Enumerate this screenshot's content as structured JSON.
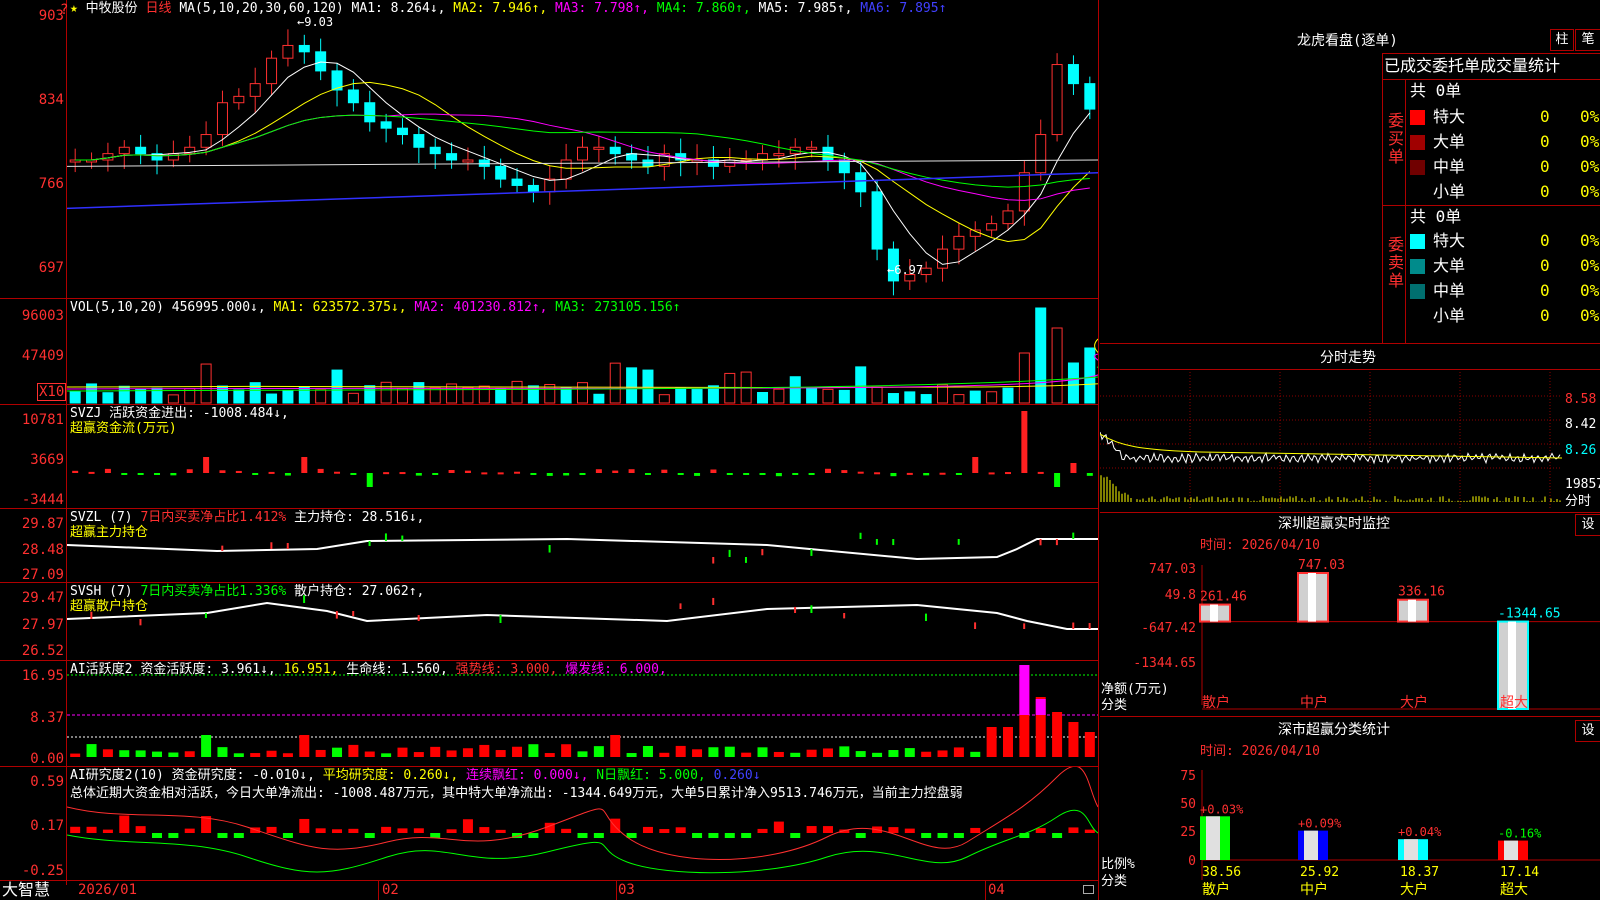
{
  "stock": {
    "star": "★",
    "name": "中牧股份",
    "period": "日线"
  },
  "ma_line": {
    "label": "MA(5,10,20,30,60,120)",
    "ma1": "MA1: 8.264↓,",
    "ma2": "MA2: 7.946↑,",
    "ma3": "MA3: 7.798↑,",
    "ma4": "MA4: 7.860↑,",
    "ma5": "MA5: 7.985↑,",
    "ma6": "MA6: 7.895↑"
  },
  "price_axis": [
    "903",
    "834",
    "766",
    "697"
  ],
  "price_annotations": {
    "high": "←9.03",
    "low": "←6.97"
  },
  "vol": {
    "label": "VOL(5,10,20)",
    "value": "456995.000↓,",
    "ma1": "MA1: 623572.375↓,",
    "ma2": "MA2: 401230.812↑,",
    "ma3": "MA3: 273105.156↑",
    "axis": [
      "96003",
      "47409"
    ],
    "unit": "X10"
  },
  "svzj": {
    "title": "SVZJ",
    "label": "活跃资金进出: -1008.484↓,",
    "sub": "超赢资金流(万元)",
    "axis": [
      "10781",
      "3669",
      "-3444"
    ]
  },
  "svzl": {
    "title": "SVZL (7)",
    "ratio": "7日内买卖净占比1.412%",
    "hold": "主力持仓: 28.516↓,",
    "sub": "超赢主力持仓",
    "axis": [
      "29.87",
      "28.48",
      "27.09"
    ]
  },
  "svsh": {
    "title": "SVSH (7)",
    "ratio": "7日内买卖净占比1.336%",
    "hold": "散户持仓: 27.062↑,",
    "sub": "超赢散户持仓",
    "axis": [
      "29.47",
      "27.97",
      "26.52"
    ]
  },
  "ai_active": {
    "title": "AI活跃度2",
    "v1": "资金活跃度: 3.961↓,",
    "v2": "16.951,",
    "v3": "生命线: 1.560,",
    "v4": "强势线: 3.000,",
    "v5": "爆发线: 6.000,",
    "axis": [
      "16.95",
      "8.37",
      "0.00"
    ]
  },
  "ai_research": {
    "title": "AI研究度2(10)",
    "v1": "资金研究度: -0.010↓,",
    "v2": "平均研究度: 0.260↓,",
    "v3": "连续飘红: 0.000↓,",
    "v4": "N日飘红: 5.000,",
    "v5": "0.260↓",
    "summary": "总体近期大资金相对活跃，今日大单净流出: -1008.487万元，其中特大单净流出: -1344.649万元，大单5日累计净入9513.746万元，当前主力控盘弱",
    "axis": [
      "0.59",
      "0.17",
      "-0.25"
    ]
  },
  "xaxis": {
    "brand": "大智慧",
    "dates": [
      "2026/01",
      "02",
      "03",
      "04"
    ]
  },
  "dragon": {
    "title": "龙虎看盘(逐单)",
    "btn_zhu": "柱",
    "btn_bi": "笔",
    "tabs": [
      "已成交",
      "委托单",
      "成交量统计"
    ],
    "buy": {
      "label": "委买单",
      "total": "共 0单",
      "rows": [
        {
          "name": "特大",
          "value": "0",
          "pct": "0%",
          "color": "#ff0000"
        },
        {
          "name": "大单",
          "value": "0",
          "pct": "0%",
          "color": "#a00000"
        },
        {
          "name": "中单",
          "value": "0",
          "pct": "0%",
          "color": "#700000"
        },
        {
          "name": "小单",
          "value": "0",
          "pct": "0%",
          "color": "#000000"
        }
      ]
    },
    "sell": {
      "label": "委卖单",
      "total": "共 0单",
      "rows": [
        {
          "name": "特大",
          "value": "0",
          "pct": "0%",
          "color": "#00ffff"
        },
        {
          "name": "大单",
          "value": "0",
          "pct": "0%",
          "color": "#008b8b"
        },
        {
          "name": "中单",
          "value": "0",
          "pct": "0%",
          "color": "#006f6f"
        },
        {
          "name": "小单",
          "value": "0",
          "pct": "0%",
          "color": "#000000"
        }
      ]
    }
  },
  "intraday": {
    "title": "分时走势",
    "axis": [
      "8.58",
      "8.42",
      "8.26"
    ],
    "vol": "19857",
    "vol_unit": "分时"
  },
  "sz_monitor": {
    "title": "深圳超赢实时监控",
    "btn": "设",
    "time": "时间: 2026/04/10",
    "axis": [
      "747.03",
      "49.8",
      "-647.42",
      "-1344.65"
    ],
    "ylabel": "净额(万元)",
    "xlabel": "分类",
    "bars": [
      {
        "cat": "散户",
        "value": 261.46,
        "label": "261.46"
      },
      {
        "cat": "中户",
        "value": 747.03,
        "label": "747.03"
      },
      {
        "cat": "大户",
        "value": 336.16,
        "label": "336.16"
      },
      {
        "cat": "超大",
        "value": -1344.65,
        "label": "-1344.65"
      }
    ]
  },
  "sz_class": {
    "title": "深市超赢分类统计",
    "btn": "设",
    "time": "时间: 2026/04/10",
    "axis": [
      "75",
      "50",
      "25",
      "0"
    ],
    "ylabel": "比例%",
    "xlabel": "分类",
    "bars": [
      {
        "cat": "散户",
        "ratio": 38.56,
        "ratio_label": "38.56",
        "change": "+0.03%",
        "color": "#00ff00",
        "cat_color": "#ffff00"
      },
      {
        "cat": "中户",
        "ratio": 25.92,
        "ratio_label": "25.92",
        "change": "+0.09%",
        "color": "#0000ff",
        "cat_color": "#ffff00"
      },
      {
        "cat": "大户",
        "ratio": 18.37,
        "ratio_label": "18.37",
        "change": "+0.04%",
        "color": "#00ffff",
        "cat_color": "#ffff00"
      },
      {
        "cat": "超大",
        "ratio": 17.14,
        "ratio_label": "17.14",
        "change": "-0.16%",
        "color": "#ff0000",
        "cat_color": "#ffff00"
      }
    ]
  }
}
